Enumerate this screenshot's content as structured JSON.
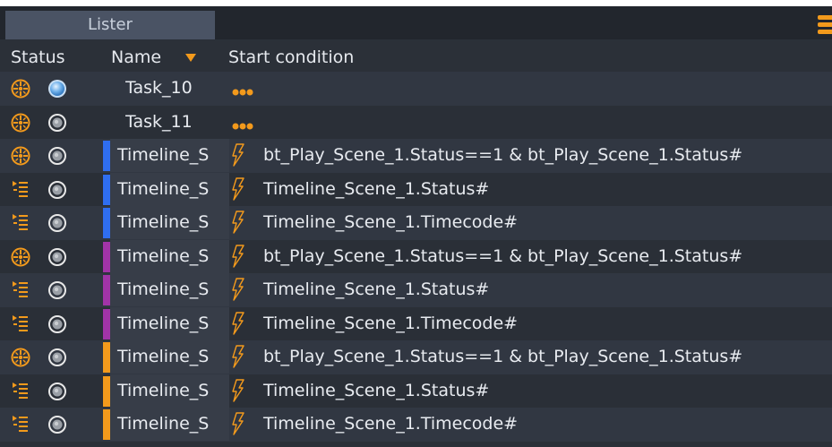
{
  "panel": {
    "tab_label": "Lister",
    "menu_icon": "hamburger-icon",
    "accent": "#f39a1c"
  },
  "columns": {
    "status": "Status",
    "name": "Name",
    "start_condition": "Start condition",
    "sort": "descending"
  },
  "rows": [
    {
      "type": "clock",
      "state": "active",
      "color": "",
      "name": "Task_10",
      "trigger": "dots",
      "condition": ""
    },
    {
      "type": "clock",
      "state": "idle",
      "color": "",
      "name": "Task_11",
      "trigger": "dots",
      "condition": ""
    },
    {
      "type": "clock",
      "state": "idle",
      "color": "#2f6ef0",
      "name": "Timeline_S",
      "trigger": "bolt",
      "condition": "bt_Play_Scene_1.Status==1 & bt_Play_Scene_1.Status#"
    },
    {
      "type": "list",
      "state": "idle",
      "color": "#2f6ef0",
      "name": "Timeline_S",
      "trigger": "bolt",
      "condition": "Timeline_Scene_1.Status#"
    },
    {
      "type": "list",
      "state": "idle",
      "color": "#2f6ef0",
      "name": "Timeline_S",
      "trigger": "bolt",
      "condition": "Timeline_Scene_1.Timecode#"
    },
    {
      "type": "clock",
      "state": "idle",
      "color": "#a234a8",
      "name": "Timeline_S",
      "trigger": "bolt",
      "condition": "bt_Play_Scene_1.Status==1 & bt_Play_Scene_1.Status#"
    },
    {
      "type": "list",
      "state": "idle",
      "color": "#a234a8",
      "name": "Timeline_S",
      "trigger": "bolt",
      "condition": "Timeline_Scene_1.Status#"
    },
    {
      "type": "list",
      "state": "idle",
      "color": "#a234a8",
      "name": "Timeline_S",
      "trigger": "bolt",
      "condition": "Timeline_Scene_1.Timecode#"
    },
    {
      "type": "clock",
      "state": "idle",
      "color": "#f39a1c",
      "name": "Timeline_S",
      "trigger": "bolt",
      "condition": "bt_Play_Scene_1.Status==1 & bt_Play_Scene_1.Status#"
    },
    {
      "type": "list",
      "state": "idle",
      "color": "#f39a1c",
      "name": "Timeline_S",
      "trigger": "bolt",
      "condition": "Timeline_Scene_1.Status#"
    },
    {
      "type": "list",
      "state": "idle",
      "color": "#f39a1c",
      "name": "Timeline_S",
      "trigger": "bolt",
      "condition": "Timeline_Scene_1.Timecode#"
    }
  ]
}
